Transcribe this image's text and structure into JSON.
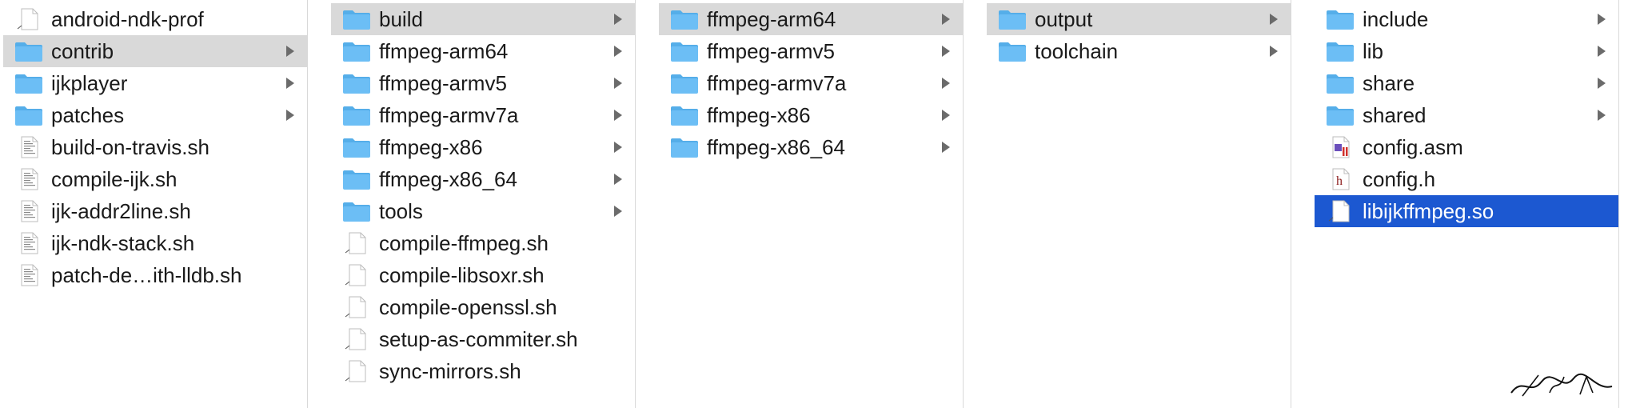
{
  "columns": [
    {
      "items": [
        {
          "label": "android-ndk-prof",
          "type": "doc"
        },
        {
          "label": "contrib",
          "type": "folder",
          "arrow": true,
          "selected": "grey"
        },
        {
          "label": "ijkplayer",
          "type": "folder",
          "arrow": true
        },
        {
          "label": "patches",
          "type": "folder",
          "arrow": true
        },
        {
          "label": "build-on-travis.sh",
          "type": "script"
        },
        {
          "label": "compile-ijk.sh",
          "type": "script"
        },
        {
          "label": "ijk-addr2line.sh",
          "type": "script"
        },
        {
          "label": "ijk-ndk-stack.sh",
          "type": "script"
        },
        {
          "label": "patch-de…ith-lldb.sh",
          "type": "script"
        }
      ]
    },
    {
      "items": [
        {
          "label": "build",
          "type": "folder",
          "arrow": true,
          "selected": "grey"
        },
        {
          "label": "ffmpeg-arm64",
          "type": "folder",
          "arrow": true
        },
        {
          "label": "ffmpeg-armv5",
          "type": "folder",
          "arrow": true
        },
        {
          "label": "ffmpeg-armv7a",
          "type": "folder",
          "arrow": true
        },
        {
          "label": "ffmpeg-x86",
          "type": "folder",
          "arrow": true
        },
        {
          "label": "ffmpeg-x86_64",
          "type": "folder",
          "arrow": true
        },
        {
          "label": "tools",
          "type": "folder",
          "arrow": true
        },
        {
          "label": "compile-ffmpeg.sh",
          "type": "doc"
        },
        {
          "label": "compile-libsoxr.sh",
          "type": "doc"
        },
        {
          "label": "compile-openssl.sh",
          "type": "doc"
        },
        {
          "label": "setup-as-commiter.sh",
          "type": "doc"
        },
        {
          "label": "sync-mirrors.sh",
          "type": "doc"
        }
      ]
    },
    {
      "items": [
        {
          "label": "ffmpeg-arm64",
          "type": "folder",
          "arrow": true,
          "selected": "grey"
        },
        {
          "label": "ffmpeg-armv5",
          "type": "folder",
          "arrow": true
        },
        {
          "label": "ffmpeg-armv7a",
          "type": "folder",
          "arrow": true
        },
        {
          "label": "ffmpeg-x86",
          "type": "folder",
          "arrow": true
        },
        {
          "label": "ffmpeg-x86_64",
          "type": "folder",
          "arrow": true
        }
      ]
    },
    {
      "items": [
        {
          "label": "output",
          "type": "folder",
          "arrow": true,
          "selected": "grey"
        },
        {
          "label": "toolchain",
          "type": "folder",
          "arrow": true
        }
      ]
    },
    {
      "items": [
        {
          "label": "include",
          "type": "folder",
          "arrow": true
        },
        {
          "label": "lib",
          "type": "folder",
          "arrow": true
        },
        {
          "label": "share",
          "type": "folder",
          "arrow": true
        },
        {
          "label": "shared",
          "type": "folder",
          "arrow": true
        },
        {
          "label": "config.asm",
          "type": "asm"
        },
        {
          "label": "config.h",
          "type": "header",
          "glyph": "h"
        },
        {
          "label": "libijkffmpeg.so",
          "type": "doc",
          "selected": "blue"
        }
      ]
    }
  ],
  "colors": {
    "folder": "#6cbef5",
    "folder_tab": "#55aee9",
    "selected_grey": "#d9d9d9",
    "selected_blue": "#1c58d1"
  }
}
